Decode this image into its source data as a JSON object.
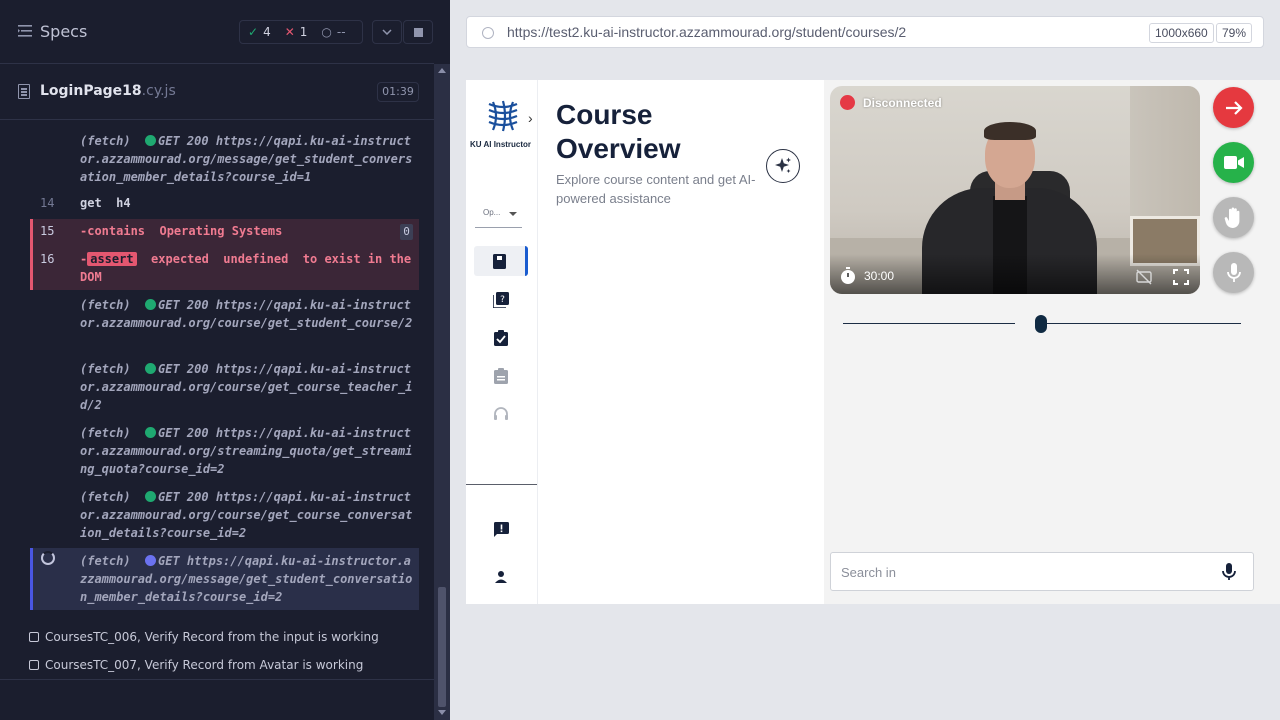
{
  "runner": {
    "specs_title": "Specs",
    "stats": {
      "passed": "4",
      "failed": "1",
      "pending": "--"
    },
    "spec_file": {
      "name": "LoginPage18",
      "ext": ".cy.js",
      "duration": "01:39"
    },
    "commands": [
      {
        "line": "",
        "text": "(fetch) GET 200 https://qapi.ku-ai-instructor.azzammourad.org/message/get_student_conversation_member_details?course_id=1",
        "kind": "fetch"
      },
      {
        "line": "14",
        "text": "get  h4",
        "kind": "plain"
      },
      {
        "line": "15",
        "text": "-contains  Operating Systems",
        "kind": "error",
        "badge": "0"
      },
      {
        "line": "16",
        "text": "expected  undefined  to exist in the DOM",
        "kind": "error",
        "assert": "assert"
      },
      {
        "line": "",
        "text": "(fetch) GET 200 https://qapi.ku-ai-instructor.azzammourad.org/course/get_student_course/2",
        "kind": "fetch"
      },
      {
        "line": "",
        "text": "(fetch) GET 200 https://qapi.ku-ai-instructor.azzammourad.org/course/get_course_teacher_id/2",
        "kind": "fetch"
      },
      {
        "line": "",
        "text": "(fetch) GET 200 https://qapi.ku-ai-instructor.azzammourad.org/streaming_quota/get_streaming_quota?course_id=2",
        "kind": "fetch"
      },
      {
        "line": "",
        "text": "(fetch) GET 200 https://qapi.ku-ai-instructor.azzammourad.org/course/get_course_conversation_details?course_id=2",
        "kind": "fetch"
      },
      {
        "line": "",
        "text": "(fetch) GET https://qapi.ku-ai-instructor.azzammourad.org/message/get_student_conversation_member_details?course_id=2",
        "kind": "active"
      }
    ],
    "tests": [
      "CoursesTC_006, Verify Record from the input is working",
      "CoursesTC_007, Verify Record from Avatar is working"
    ]
  },
  "aut": {
    "url": "https://test2.ku-ai-instructor.azzammourad.org/student/courses/2",
    "viewport": "1000x660",
    "zoom": "79%"
  },
  "app": {
    "logo_text": "KU AI Instructor",
    "language_select": "Op...",
    "title": "Course Overview",
    "subtitle": "Explore course content and get AI-powered assistance",
    "video": {
      "status": "Disconnected",
      "timer": "30:00"
    },
    "search_placeholder": "Search in",
    "colors": {
      "accent": "#1a5ccf",
      "leave": "#e5393f",
      "camera": "#26b24a",
      "disabled": "#b8b8b8"
    }
  }
}
